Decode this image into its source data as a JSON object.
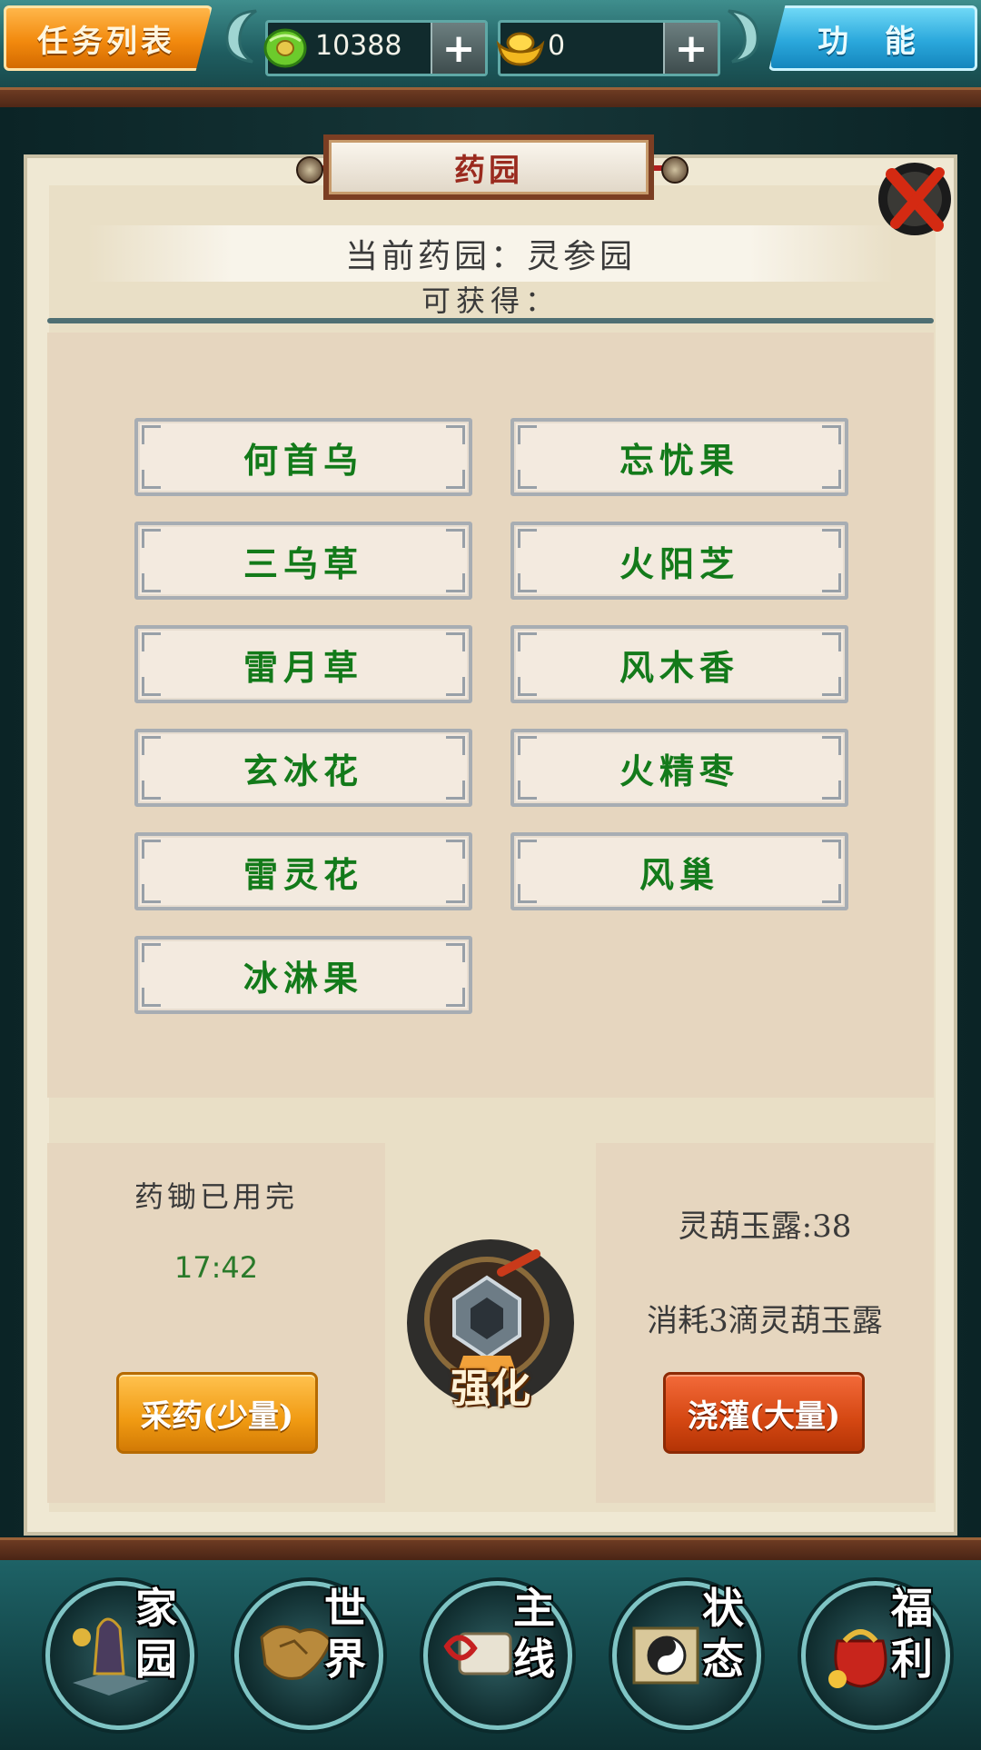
{
  "topbar": {
    "task_list_label": "任务列表",
    "function_label": "功 能",
    "jade_amount": "10388",
    "ingot_amount": "0",
    "plus_label": "+"
  },
  "dialog": {
    "title": "药园",
    "current_garden": "当前药园：灵参园",
    "obtainable_label": "可获得：",
    "herbs": [
      "何首乌",
      "忘忧果",
      "三乌草",
      "火阳芝",
      "雷月草",
      "风木香",
      "玄冰花",
      "火精枣",
      "雷灵花",
      "风巢",
      "冰淋果"
    ]
  },
  "harvest": {
    "status": "药锄已用完",
    "timer": "17:42",
    "button_label": "采药(少量)"
  },
  "strengthen": {
    "label": "强化"
  },
  "water": {
    "dew_count": "灵葫玉露:38",
    "cost_text": "消耗3滴灵葫玉露",
    "button_label": "浇灌(大量)"
  },
  "nav": {
    "items": [
      {
        "label": "家园",
        "icon": "home-icon"
      },
      {
        "label": "世界",
        "icon": "world-map-icon"
      },
      {
        "label": "主线",
        "icon": "main-quest-icon"
      },
      {
        "label": "状态",
        "icon": "status-bagua-icon"
      },
      {
        "label": "福利",
        "icon": "welfare-bag-icon"
      }
    ]
  },
  "colors": {
    "herb_text": "#137a1a",
    "accent_orange": "#f09a12",
    "accent_red": "#d44712",
    "accent_blue": "#2ba8dc"
  }
}
